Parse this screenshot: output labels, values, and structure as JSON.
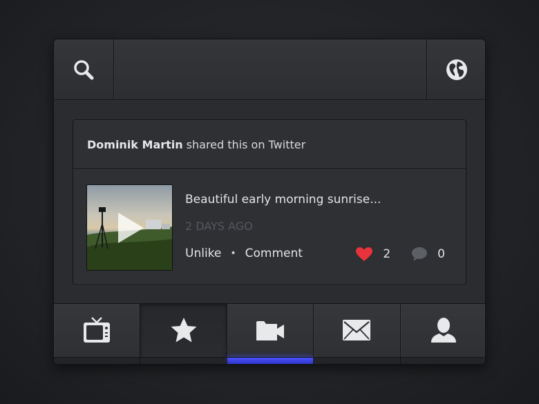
{
  "topbar": {
    "search_icon": "search-icon",
    "globe_icon": "globe-icon"
  },
  "post": {
    "author": "Dominik Martin",
    "shared_text": "shared this on Twitter",
    "thumbnail_icon": "play-icon",
    "text": "Beautiful early morning sunrise...",
    "time": "2 DAYS AGO",
    "unlike_label": "Unlike",
    "separator": "•",
    "comment_label": "Comment",
    "likes_count": "2",
    "comments_count": "0",
    "heart_color": "#e8333a"
  },
  "nav": {
    "items": [
      {
        "icon": "tv-icon"
      },
      {
        "icon": "star-icon"
      },
      {
        "icon": "video-folder-icon"
      },
      {
        "icon": "mail-icon"
      },
      {
        "icon": "user-icon"
      }
    ],
    "active_index": 1,
    "selected_index": 2,
    "accent_color": "#4a52ff"
  }
}
